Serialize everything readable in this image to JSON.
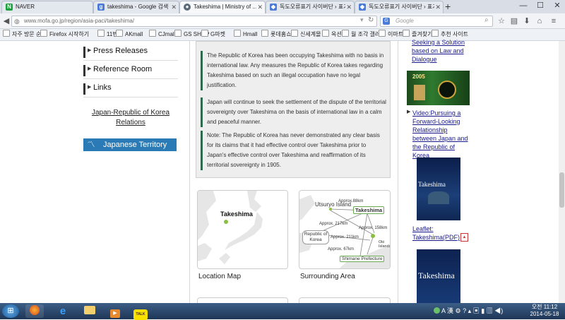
{
  "browser": {
    "tabs": [
      {
        "title": "NAVER",
        "icon": "N",
        "color": "#19a23b",
        "active": false
      },
      {
        "title": "takeshima - Google 검색",
        "icon": "g",
        "color": "#4a7bd8",
        "active": false
      },
      {
        "title": "Takeshima | Ministry of ...",
        "icon": "●",
        "color": "#5a6a7a",
        "active": true
      },
      {
        "title": "독도오류표기 사이버단 › 표기...",
        "icon": "◆",
        "color": "#4a7bd8",
        "active": false
      },
      {
        "title": "독도오류표기 사이버단 › 표기...",
        "icon": "◆",
        "color": "#4a7bd8",
        "active": false
      }
    ],
    "new_tab": "+",
    "window": {
      "minimize": "—",
      "maximize": "☐",
      "close": "✕"
    },
    "url": "www.mofa.go.jp/region/asia-paci/takeshima/",
    "search_placeholder": "Google",
    "search_engine_badge": "G",
    "bookmarks": [
      "자주 방문 순",
      "Firefox 시작하기",
      "11번가",
      "AKmall",
      "CJmall",
      "GS SHOP",
      "G마켓",
      "Hmall",
      "롯데홈쇼핑",
      "신세계몰",
      "옥션",
      "월 조각 갤러리",
      "이마트",
      "즐겨찾기",
      "추천 사이트"
    ]
  },
  "sidebar": {
    "items": [
      {
        "label": "Press Releases"
      },
      {
        "label": "Reference Room"
      },
      {
        "label": "Links"
      }
    ],
    "relations_link": "Japan-Republic of Korea Relations",
    "territory_button": "Japanese Territory"
  },
  "main": {
    "paragraphs": [
      "The Republic of Korea has been occupying Takeshima with no basis in international law. Any measures the Republic of Korea takes regarding Takeshima based on such an illegal occupation have no legal justification.",
      "Japan will continue to seek the settlement of the dispute of the territorial sovereignty over Takeshima on the basis of international law in a calm and peaceful manner.",
      "Note: The Republic of Korea has never demonstrated any clear basis for its claims that it had effective control over Takeshima prior to Japan's effective control over Takeshima and reaffirmation of its territorial sovereignty in 1905."
    ],
    "location_map": {
      "map_label": "Takeshima",
      "caption": "Location Map"
    },
    "surrounding_map": {
      "caption": "Surrounding Area",
      "labels": {
        "utsuryo": "Utsuryo Island",
        "takeshima": "Takeshima",
        "korea": "Republic of Korea",
        "oki": "Oki Islands",
        "shimane": "Shimane Prefecture",
        "d88": "Approx.88km",
        "d217": "Approx. 217km",
        "d158": "Approx. 158km",
        "d211": "Approx. 211km",
        "d67": "Approx. 67km"
      }
    }
  },
  "right_column": {
    "top_link": "Seeking a Solution based on Law and Dialogue",
    "video_link": "Video:Pursuing a Forward-Looking Relationship between Japan and the Republic of Korea",
    "video_thumb_title": "2005",
    "leaflet_thumb_title": "Takeshima",
    "leaflet_link": "Leaflet: Takeshima(PDF)",
    "book_thumb_title": "Takeshima"
  },
  "taskbar": {
    "apps": [
      "start",
      "firefox",
      "ie",
      "explorer",
      "media",
      "kakaotalk"
    ],
    "kakaotalk_label": "TALK",
    "tray_text": "A 漢",
    "time": "오전 11:12",
    "date": "2014-05-18"
  },
  "colors": {
    "accent_blue": "#2a7bb5",
    "paragraph_bar": "#2e6b4e",
    "taskbar": "#26426a",
    "link": "#1a1a8c"
  }
}
